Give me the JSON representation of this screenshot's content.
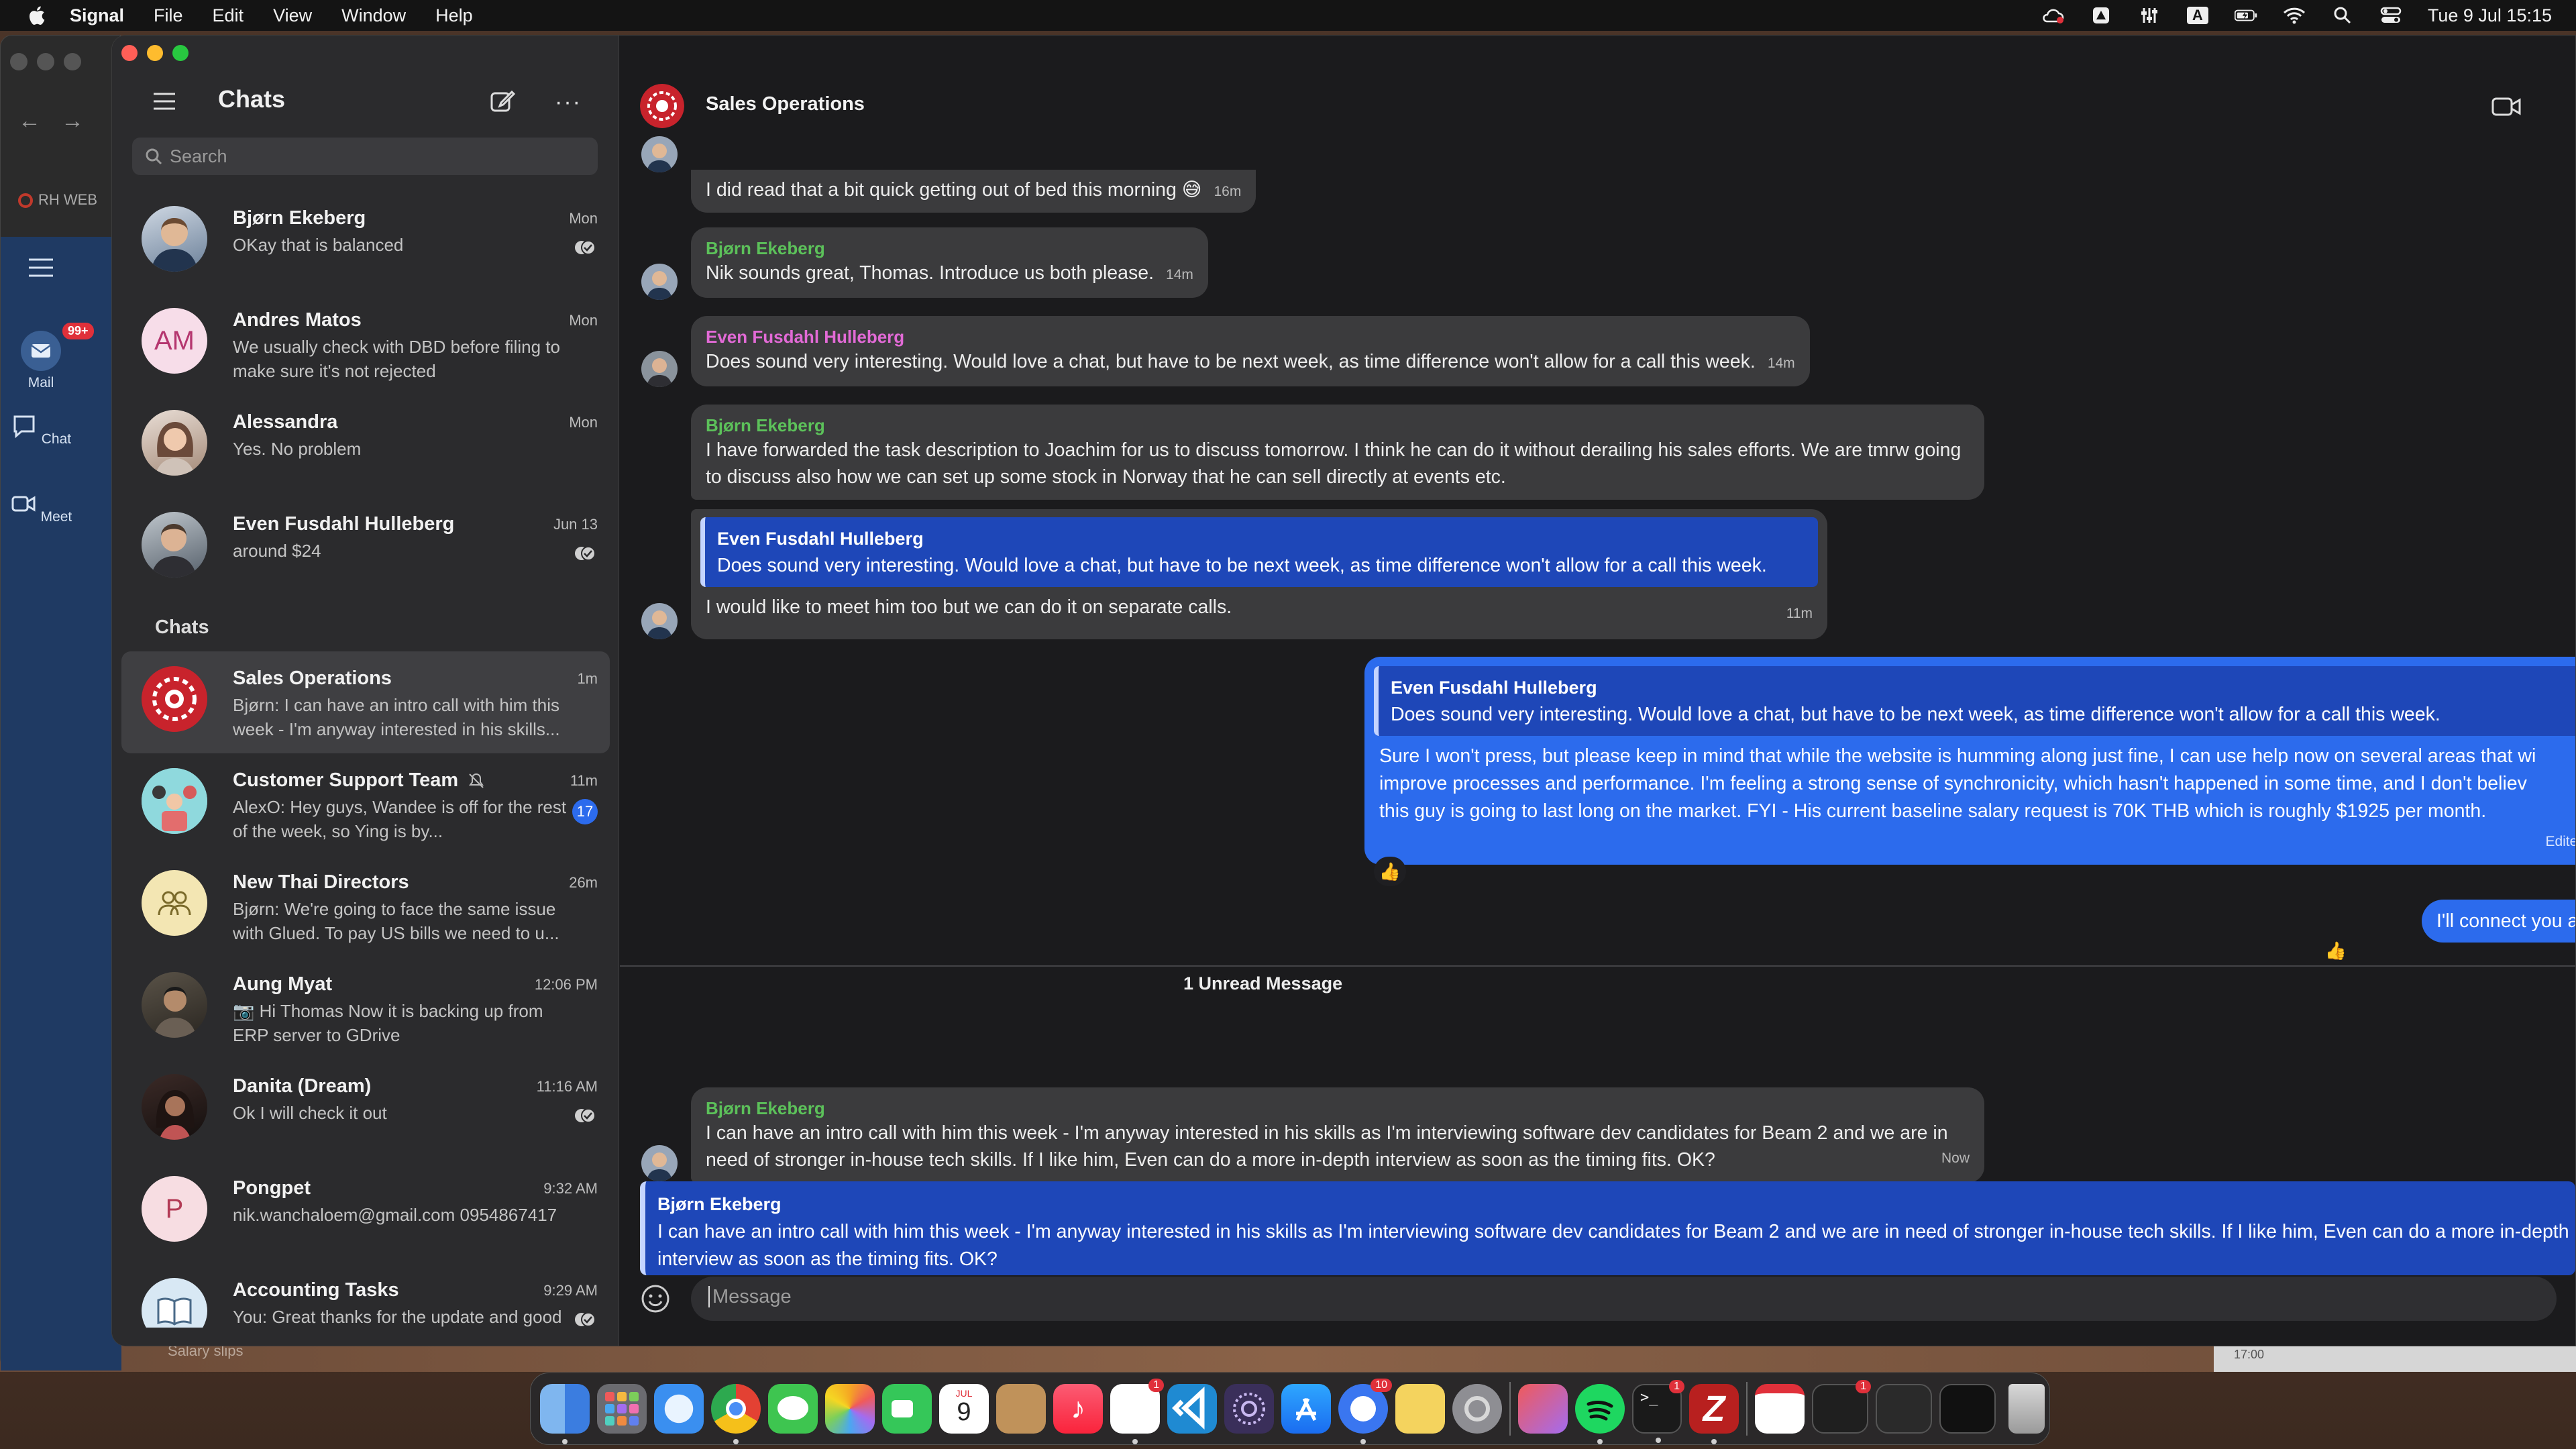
{
  "menubar": {
    "app": "Signal",
    "items": [
      "File",
      "Edit",
      "View",
      "Window",
      "Help"
    ],
    "clock": "Tue 9 Jul  15:15",
    "status_icons": [
      "cloud-sync-icon",
      "drive-icon",
      "equalizer-icon",
      "input-source-icon",
      "battery-icon",
      "wifi-icon",
      "spotlight-icon",
      "control-center-icon"
    ],
    "input_source_label": "A"
  },
  "background_window": {
    "tab_text": "RH WEB",
    "teams": {
      "mail_label": "Mail",
      "mail_badge": "99+",
      "chat_label": "Chat",
      "meet_label": "Meet"
    },
    "desktop_label": "Salary slips",
    "desktop_time": "17:00"
  },
  "sidebar": {
    "title": "Chats",
    "search_placeholder": "Search",
    "section_label": "Chats",
    "pinned": [
      {
        "name": "Bjørn Ekeberg",
        "preview": "OKay that is balanced",
        "time": "Mon",
        "read": true
      },
      {
        "name": "Andres Matos",
        "initials": "AM",
        "preview": "We usually check with DBD before filing to make sure it's not rejected",
        "time": "Mon"
      },
      {
        "name": "Alessandra",
        "preview": "Yes. No problem",
        "time": "Mon"
      },
      {
        "name": "Even Fusdahl Hulleberg",
        "preview": "around $24",
        "time": "Jun 13",
        "read": true
      }
    ],
    "chats": [
      {
        "name": "Sales Operations",
        "preview": "Bjørn: I can have an intro call with him this week - I'm anyway interested in his skills...",
        "time": "1m",
        "selected": true
      },
      {
        "name": "Customer Support Team",
        "preview": "AlexO: Hey guys, Wandee is off for the rest of the week, so Ying is by...",
        "time": "11m",
        "unread": "17",
        "muted": true
      },
      {
        "name": "New Thai Directors",
        "preview": "Bjørn: We're going to face the same issue with Glued. To pay US bills we need to u...",
        "time": "26m"
      },
      {
        "name": "Aung Myat",
        "preview": "📷 Hi Thomas Now it is backing up from ERP server to GDrive",
        "time": "12:06 PM"
      },
      {
        "name": "Danita (Dream)",
        "preview": "Ok I will check it out",
        "time": "11:16 AM",
        "read": true
      },
      {
        "name": "Pongpet",
        "initials": "P",
        "preview": "nik.wanchaloem@gmail.com 0954867417",
        "time": "9:32 AM"
      },
      {
        "name": "Accounting Tasks",
        "preview": "You: Great thanks for the update and good work!",
        "time": "9:29 AM",
        "read": true
      }
    ]
  },
  "conversation": {
    "title": "Sales Operations",
    "messages": [
      {
        "text": "I did read that a bit quick getting out of bed this morning 😅",
        "time": "16m"
      },
      {
        "author": "Bjørn Ekeberg",
        "text": "Nik sounds great, Thomas. Introduce us both please.",
        "time": "14m"
      },
      {
        "author": "Even Fusdahl Hulleberg",
        "text": "Does sound very interesting. Would love a chat, but have to be next week, as time difference won't allow for a call this week.",
        "time": "14m"
      },
      {
        "author": "Bjørn Ekeberg",
        "text": "I have forwarded the task description to Joachim for us to discuss tomorrow. I think he can do it without derailing his sales efforts. We are tmrw going to discuss also how we can set up some stock in Norway that he can sell directly at events etc."
      },
      {
        "quote_author": "Even Fusdahl Hulleberg",
        "quote_text": "Does sound very interesting. Would love a chat, but have to be next week, as time difference won't allow for a call this week.",
        "text": "I would like to meet him too but we can do it on separate calls.",
        "time": "11m"
      },
      {
        "outgoing": true,
        "quote_author": "Even Fusdahl Hulleberg",
        "quote_text": "Does sound very interesting. Would love a chat, but have to be next week, as time difference won't allow for a call this week.",
        "text_lines": [
          "Sure I won't press, but please keep in mind that while the website is humming along just fine, I can use help now on several areas that wi",
          "improve processes and performance.  I'm feeling a strong sense of synchronicity, which hasn't happened in some time, and I don't believ",
          "this guy is going to last long on the market.   FYI - His current baseline salary request is 70K THB which is roughly $1925 per month."
        ],
        "edited": "Edited",
        "reaction": "👍"
      },
      {
        "outgoing": true,
        "text": "I'll connect you all via email.",
        "reaction": "👍"
      }
    ],
    "unread_divider": "1 Unread Message",
    "last_message": {
      "author": "Bjørn Ekeberg",
      "text": "I can have an intro call with him this week - I'm anyway interested in his skills as I'm interviewing software dev candidates for Beam 2 and we are in need of stronger in-house tech skills. If I like him, Even can do a more in-depth interview as soon as the timing fits. OK?",
      "time": "Now"
    },
    "reply_preview": {
      "author": "Bjørn Ekeberg",
      "text": "I can have an intro call with him this week - I'm anyway interested in his skills as I'm interviewing software dev candidates for Beam 2 and we are in need of stronger in-house tech skills. If I like him, Even can do a more in-depth interview as soon as the timing fits. OK?"
    },
    "composer_placeholder": "Message"
  },
  "colors": {
    "accent": "#2c6bed",
    "author_green": "#5cc15a",
    "author_pink": "#e26ad6"
  },
  "dock": {
    "apps": [
      "finder",
      "launchpad",
      "safari",
      "chrome",
      "messages",
      "photos",
      "facetime",
      "calendar",
      "contacts",
      "music",
      "reminders",
      "vscode",
      "spiral-app",
      "app-store",
      "signal",
      "notes-app",
      "system-settings",
      "creative-cloud",
      "spotify",
      "terminal",
      "filezilla",
      "calendar-app",
      "screen-1",
      "screen-2",
      "screen-3",
      "trash"
    ],
    "calendar_month": "JUL",
    "calendar_day": "9",
    "badges": {
      "reminders": "1",
      "signal": "10",
      "terminal": "1",
      "screen-1": "1"
    }
  }
}
